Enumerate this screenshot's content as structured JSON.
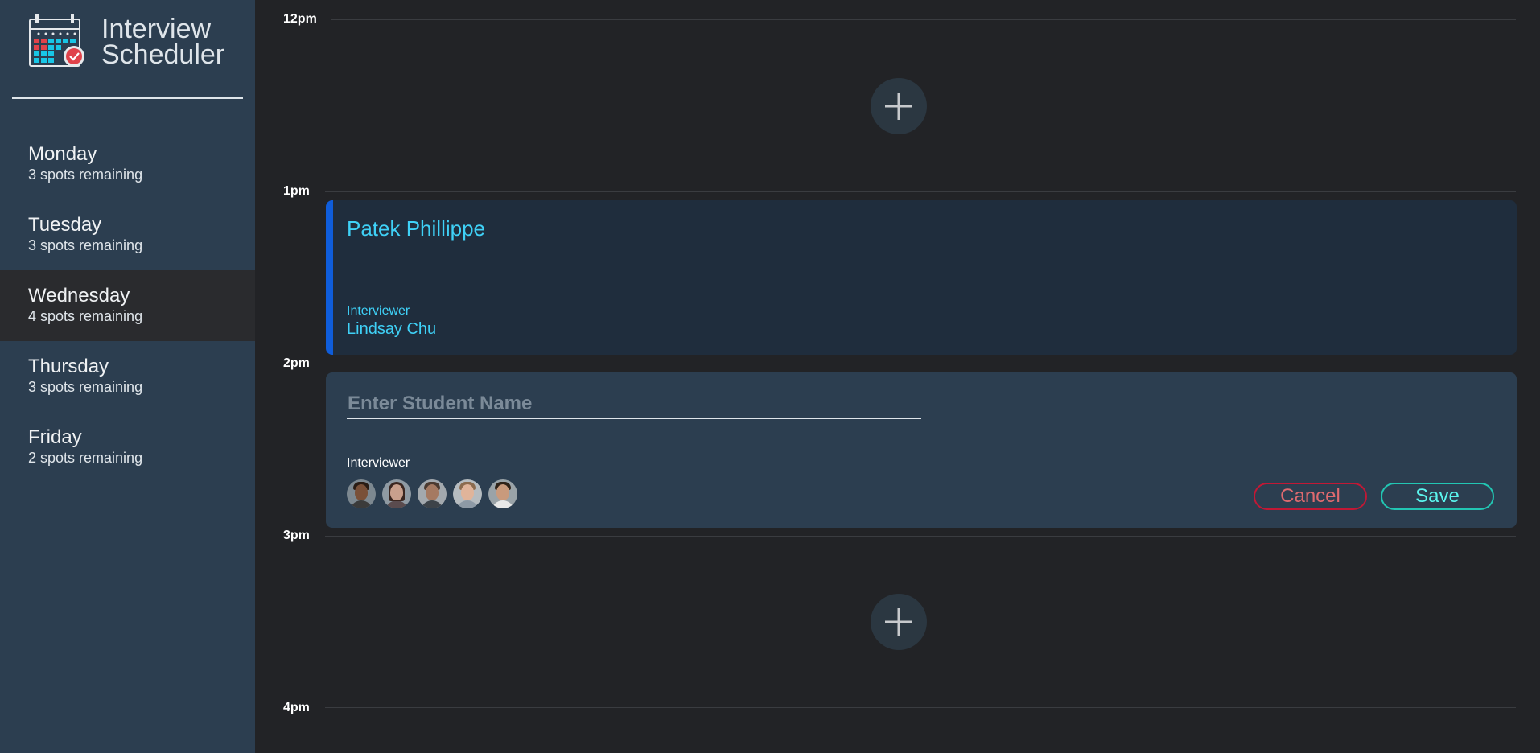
{
  "app": {
    "title_line1": "Interview",
    "title_line2": "Scheduler"
  },
  "sidebar": {
    "days": [
      {
        "name": "Monday",
        "spots": "3 spots remaining",
        "selected": false
      },
      {
        "name": "Tuesday",
        "spots": "3 spots remaining",
        "selected": false
      },
      {
        "name": "Wednesday",
        "spots": "4 spots remaining",
        "selected": true
      },
      {
        "name": "Thursday",
        "spots": "3 spots remaining",
        "selected": false
      },
      {
        "name": "Friday",
        "spots": "2 spots remaining",
        "selected": false
      }
    ]
  },
  "schedule": {
    "hours": [
      "12pm",
      "1pm",
      "2pm",
      "3pm",
      "4pm"
    ],
    "booked": {
      "student": "Patek Phillippe",
      "interviewer_label": "Interviewer",
      "interviewer_name": "Lindsay Chu"
    },
    "form": {
      "student_placeholder": "Enter Student Name",
      "student_value": "",
      "interviewer_label": "Interviewer",
      "cancel_label": "Cancel",
      "save_label": "Save"
    }
  },
  "colors": {
    "sidebar_bg": "#2c3e50",
    "main_bg": "#222326",
    "accent_cyan": "#3fd1f7",
    "booked_border": "#0f5ddb",
    "cancel": "#c21835",
    "save": "#22c6b3"
  },
  "icons": {
    "brand": "calendar-check-icon",
    "add": "plus-icon",
    "avatars": [
      "interviewer-avatar-1",
      "interviewer-avatar-2",
      "interviewer-avatar-3",
      "interviewer-avatar-4",
      "interviewer-avatar-5"
    ]
  }
}
